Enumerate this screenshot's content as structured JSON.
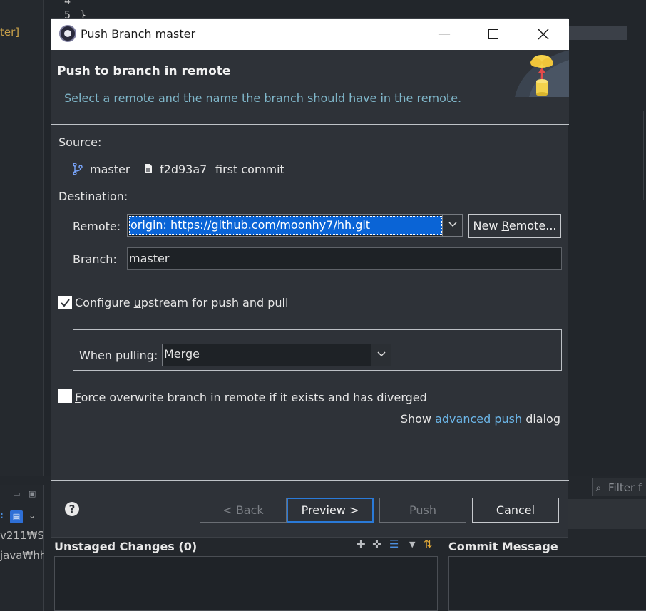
{
  "background": {
    "left_fragment": "ter]",
    "gutter": {
      "line4": "4",
      "line5": "5",
      "brace": "}"
    },
    "path_line1": "v211₩St",
    "path_line2": "java₩hh",
    "filter_placeholder": "Filter f",
    "unstaged_title": "Unstaged Changes (0)",
    "commit_title": "Commit Message"
  },
  "dialog": {
    "window_title": "Push Branch master",
    "header_title": "Push to branch in remote",
    "header_description": "Select a remote and the name the branch should have in the remote.",
    "source_label": "Source:",
    "source": {
      "branch": "master",
      "commit_id": "f2d93a7",
      "commit_message": "first commit"
    },
    "destination_label": "Destination:",
    "remote_label": "Remote:",
    "remote_value": "origin: https://github.com/moonhy7/hh.git",
    "new_remote_label_pre": "New ",
    "new_remote_label_u": "R",
    "new_remote_label_post": "emote...",
    "branch_label": "Branch:",
    "branch_value": "master",
    "upstream_pre": "Configure ",
    "upstream_u": "u",
    "upstream_post": "pstream for push and pull",
    "upstream_checked": true,
    "when_pulling_label": "When pulling:",
    "when_pulling_value": "Merge",
    "force_u": "F",
    "force_post": "orce overwrite branch in remote if it exists and has diverged",
    "force_checked": false,
    "advanced_pre": "Show ",
    "advanced_link": "advanced push",
    "advanced_post": " dialog",
    "buttons": {
      "back": "< Back",
      "preview_pre": "Pre",
      "preview_u": "v",
      "preview_post": "iew >",
      "push": "Push",
      "cancel": "Cancel"
    }
  },
  "colors": {
    "link": "#6cb6e8",
    "selection": "#0a64d6",
    "header_description": "#7fb6c9"
  }
}
